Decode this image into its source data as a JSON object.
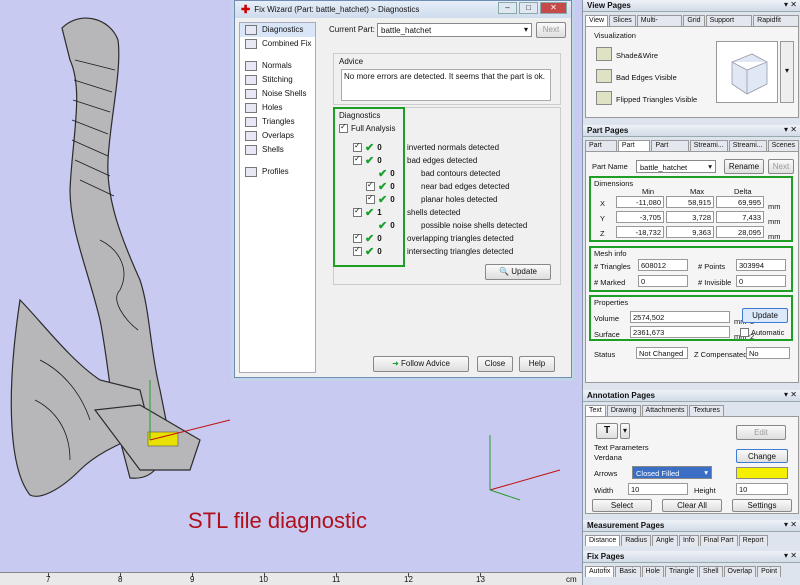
{
  "caption": "STL file diagnostic",
  "ruler": {
    "unit": "cm",
    "ticks": [
      "7",
      "8",
      "9",
      "10",
      "11",
      "12",
      "13"
    ]
  },
  "wizard": {
    "title": "Fix Wizard (Part: battle_hatchet) > Diagnostics",
    "nav": [
      "Diagnostics",
      "Combined Fix",
      "Normals",
      "Stitching",
      "Noise Shells",
      "Holes",
      "Triangles",
      "Overlaps",
      "Shells",
      "Profiles"
    ],
    "current_part_label": "Current Part:",
    "current_part": "battle_hatchet",
    "next_label": "Next",
    "advice_title": "Advice",
    "advice_text": "No more errors are detected. It seems that the part is ok.",
    "diagnostics_title": "Diagnostics",
    "full_analysis": "Full Analysis",
    "rows": [
      {
        "count": "0",
        "label": "inverted normals detected"
      },
      {
        "count": "0",
        "label": "bad edges detected"
      },
      {
        "count": "0",
        "label": "bad contours detected"
      },
      {
        "count": "0",
        "label": "near bad edges detected"
      },
      {
        "count": "0",
        "label": "planar holes detected"
      },
      {
        "count": "1",
        "label": "shells detected"
      },
      {
        "count": "0",
        "label": "possible noise shells detected"
      },
      {
        "count": "0",
        "label": "overlapping triangles detected"
      },
      {
        "count": "0",
        "label": "intersecting triangles detected"
      }
    ],
    "update": "Update",
    "follow_advice": "Follow Advice",
    "close": "Close",
    "help": "Help"
  },
  "view_pages": {
    "title": "View Pages",
    "tabs": [
      "View",
      "Slices",
      "Multi-Section",
      "Grid",
      "Support View",
      "Rapidfit View"
    ],
    "group": "Visualization",
    "items": [
      "Shade&Wire",
      "Bad Edges Visible",
      "Flipped Triangles Visible"
    ]
  },
  "part_pages": {
    "title": "Part Pages",
    "tabs": [
      "Part List",
      "Part Info",
      "Part Fixi...",
      "Streami...",
      "Streami...",
      "Scenes"
    ],
    "part_name_label": "Part Name",
    "part_name": "battle_hatchet",
    "rename": "Rename",
    "next": "Next",
    "dimensions": {
      "title": "Dimensions",
      "headers": [
        "Min",
        "Max",
        "Delta"
      ],
      "rows": [
        {
          "axis": "X",
          "min": "-11,080",
          "max": "58,915",
          "delta": "69,995",
          "unit": "mm"
        },
        {
          "axis": "Y",
          "min": "-3,705",
          "max": "3,728",
          "delta": "7,433",
          "unit": "mm"
        },
        {
          "axis": "Z",
          "min": "-18,732",
          "max": "9,363",
          "delta": "28,095",
          "unit": "mm"
        }
      ]
    },
    "mesh": {
      "title": "Mesh info",
      "triangles_label": "# Triangles",
      "triangles": "608012",
      "points_label": "# Points",
      "points": "303994",
      "marked_label": "# Marked",
      "marked": "0",
      "invisible_label": "# Invisible",
      "invisible": "0"
    },
    "properties": {
      "title": "Properties",
      "volume_label": "Volume",
      "volume": "2574,502",
      "volume_unit": "mm^3",
      "surface_label": "Surface",
      "surface": "2361,673",
      "surface_unit": "mm^2",
      "update": "Update",
      "automatic": "Automatic"
    },
    "status_label": "Status",
    "status": "Not Changed",
    "zcomp_label": "Z Compensated",
    "zcomp": "No"
  },
  "annotation_pages": {
    "title": "Annotation Pages",
    "tabs": [
      "Text",
      "Drawing",
      "Attachments",
      "Textures"
    ],
    "edit": "Edit",
    "params_label": "Text Parameters",
    "font": "Verdana",
    "change_font": "Change Font...",
    "arrows_label": "Arrows",
    "arrows": "Closed Filled",
    "width_label": "Width",
    "width": "10",
    "height_label": "Height",
    "height": "10",
    "select": "Select",
    "clear_all": "Clear All",
    "settings": "Settings"
  },
  "measurement_pages": {
    "title": "Measurement Pages",
    "tabs": [
      "Distance",
      "Radius",
      "Angle",
      "Info",
      "Final Part",
      "Report"
    ]
  },
  "fix_pages": {
    "title": "Fix Pages",
    "tabs": [
      "Autofix",
      "Basic",
      "Hole",
      "Triangle",
      "Shell",
      "Overlap",
      "Point"
    ]
  }
}
